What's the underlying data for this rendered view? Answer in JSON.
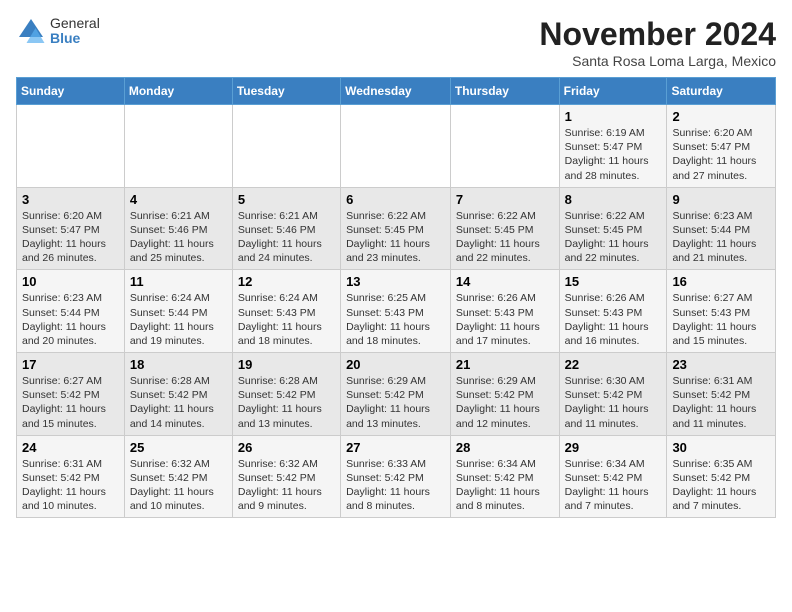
{
  "logo": {
    "general": "General",
    "blue": "Blue"
  },
  "title": "November 2024",
  "subtitle": "Santa Rosa Loma Larga, Mexico",
  "weekdays": [
    "Sunday",
    "Monday",
    "Tuesday",
    "Wednesday",
    "Thursday",
    "Friday",
    "Saturday"
  ],
  "weeks": [
    [
      {
        "day": "",
        "text": ""
      },
      {
        "day": "",
        "text": ""
      },
      {
        "day": "",
        "text": ""
      },
      {
        "day": "",
        "text": ""
      },
      {
        "day": "",
        "text": ""
      },
      {
        "day": "1",
        "text": "Sunrise: 6:19 AM\nSunset: 5:47 PM\nDaylight: 11 hours and 28 minutes."
      },
      {
        "day": "2",
        "text": "Sunrise: 6:20 AM\nSunset: 5:47 PM\nDaylight: 11 hours and 27 minutes."
      }
    ],
    [
      {
        "day": "3",
        "text": "Sunrise: 6:20 AM\nSunset: 5:47 PM\nDaylight: 11 hours and 26 minutes."
      },
      {
        "day": "4",
        "text": "Sunrise: 6:21 AM\nSunset: 5:46 PM\nDaylight: 11 hours and 25 minutes."
      },
      {
        "day": "5",
        "text": "Sunrise: 6:21 AM\nSunset: 5:46 PM\nDaylight: 11 hours and 24 minutes."
      },
      {
        "day": "6",
        "text": "Sunrise: 6:22 AM\nSunset: 5:45 PM\nDaylight: 11 hours and 23 minutes."
      },
      {
        "day": "7",
        "text": "Sunrise: 6:22 AM\nSunset: 5:45 PM\nDaylight: 11 hours and 22 minutes."
      },
      {
        "day": "8",
        "text": "Sunrise: 6:22 AM\nSunset: 5:45 PM\nDaylight: 11 hours and 22 minutes."
      },
      {
        "day": "9",
        "text": "Sunrise: 6:23 AM\nSunset: 5:44 PM\nDaylight: 11 hours and 21 minutes."
      }
    ],
    [
      {
        "day": "10",
        "text": "Sunrise: 6:23 AM\nSunset: 5:44 PM\nDaylight: 11 hours and 20 minutes."
      },
      {
        "day": "11",
        "text": "Sunrise: 6:24 AM\nSunset: 5:44 PM\nDaylight: 11 hours and 19 minutes."
      },
      {
        "day": "12",
        "text": "Sunrise: 6:24 AM\nSunset: 5:43 PM\nDaylight: 11 hours and 18 minutes."
      },
      {
        "day": "13",
        "text": "Sunrise: 6:25 AM\nSunset: 5:43 PM\nDaylight: 11 hours and 18 minutes."
      },
      {
        "day": "14",
        "text": "Sunrise: 6:26 AM\nSunset: 5:43 PM\nDaylight: 11 hours and 17 minutes."
      },
      {
        "day": "15",
        "text": "Sunrise: 6:26 AM\nSunset: 5:43 PM\nDaylight: 11 hours and 16 minutes."
      },
      {
        "day": "16",
        "text": "Sunrise: 6:27 AM\nSunset: 5:43 PM\nDaylight: 11 hours and 15 minutes."
      }
    ],
    [
      {
        "day": "17",
        "text": "Sunrise: 6:27 AM\nSunset: 5:42 PM\nDaylight: 11 hours and 15 minutes."
      },
      {
        "day": "18",
        "text": "Sunrise: 6:28 AM\nSunset: 5:42 PM\nDaylight: 11 hours and 14 minutes."
      },
      {
        "day": "19",
        "text": "Sunrise: 6:28 AM\nSunset: 5:42 PM\nDaylight: 11 hours and 13 minutes."
      },
      {
        "day": "20",
        "text": "Sunrise: 6:29 AM\nSunset: 5:42 PM\nDaylight: 11 hours and 13 minutes."
      },
      {
        "day": "21",
        "text": "Sunrise: 6:29 AM\nSunset: 5:42 PM\nDaylight: 11 hours and 12 minutes."
      },
      {
        "day": "22",
        "text": "Sunrise: 6:30 AM\nSunset: 5:42 PM\nDaylight: 11 hours and 11 minutes."
      },
      {
        "day": "23",
        "text": "Sunrise: 6:31 AM\nSunset: 5:42 PM\nDaylight: 11 hours and 11 minutes."
      }
    ],
    [
      {
        "day": "24",
        "text": "Sunrise: 6:31 AM\nSunset: 5:42 PM\nDaylight: 11 hours and 10 minutes."
      },
      {
        "day": "25",
        "text": "Sunrise: 6:32 AM\nSunset: 5:42 PM\nDaylight: 11 hours and 10 minutes."
      },
      {
        "day": "26",
        "text": "Sunrise: 6:32 AM\nSunset: 5:42 PM\nDaylight: 11 hours and 9 minutes."
      },
      {
        "day": "27",
        "text": "Sunrise: 6:33 AM\nSunset: 5:42 PM\nDaylight: 11 hours and 8 minutes."
      },
      {
        "day": "28",
        "text": "Sunrise: 6:34 AM\nSunset: 5:42 PM\nDaylight: 11 hours and 8 minutes."
      },
      {
        "day": "29",
        "text": "Sunrise: 6:34 AM\nSunset: 5:42 PM\nDaylight: 11 hours and 7 minutes."
      },
      {
        "day": "30",
        "text": "Sunrise: 6:35 AM\nSunset: 5:42 PM\nDaylight: 11 hours and 7 minutes."
      }
    ]
  ]
}
